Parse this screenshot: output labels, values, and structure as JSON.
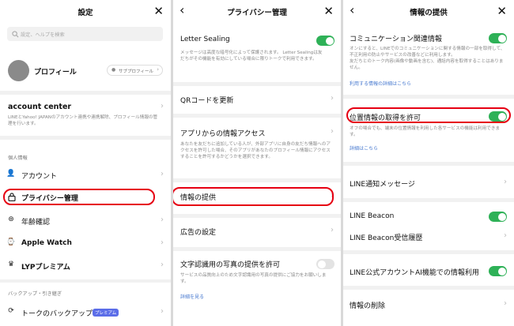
{
  "panel1": {
    "title": "設定",
    "search_placeholder": "設定、ヘルプを検索",
    "profile_label": "プロフィール",
    "sub_profile_button": "サブプロフィール",
    "account_center_title": "account center",
    "account_center_desc": "LINEとYahoo! JAPANのアカウント連携や連携解除、プロフィール情報の管理を行います。",
    "section_personal": "個人情報",
    "items": [
      "アカウント",
      "プライバシー管理",
      "年齢確認",
      "Apple Watch",
      "LYPプレミアム"
    ],
    "section_backup": "バックアップ・引き継ぎ",
    "backup_label": "トークのバックアップ",
    "premium_badge": "プレミアム"
  },
  "panel2": {
    "title": "プライバシー管理",
    "letter_sealing_title": "Letter Sealing",
    "letter_sealing_desc": "メッセージは高度な暗号化によって保護されます。 Letter Sealingは友だちがその機能を有効にしている場合に限りトークで利用できます。",
    "qr_label": "QRコードを更新",
    "app_access_title": "アプリからの情報アクセス",
    "app_access_desc": "あなたを友だちに追加している人が、外部アプリに自身の友だち情報へのアクセスを許可した場合、そのアプリがあなたのプロフィール情報にアクセスすることを許可するかどうかを選択できます。",
    "provide_info_label": "情報の提供",
    "ad_settings_label": "広告の設定",
    "photo_title": "文字認識用の写真の提供を許可",
    "photo_desc": "サービスの品質向上のため文字認識用の写真の提供にご協力をお願いします。",
    "details_link": "詳細を見る"
  },
  "panel3": {
    "title": "情報の提供",
    "comm_title": "コミュニケーション関連情報",
    "comm_desc": "オンにすると、LINEでのコミュニケーションに関する情報の一部を取得して、不正利用の防止やサービスの改善などに利用します。\n友だちとのトーク内容(画像や動画を含む)、通話内容を取得することはありません。",
    "comm_link": "利用する情報の詳細はこちら",
    "location_title": "位置情報の取得を許可",
    "location_desc": "オフの場合でも、端末の位置情報を利用した各サービスの機能は利用できます。",
    "details_link": "詳細はこちら",
    "line_notify": "LINE通知メッセージ",
    "line_beacon": "LINE Beacon",
    "beacon_history": "LINE Beacon受信履歴",
    "official_ai": "LINE公式アカウントAI機能での情報利用",
    "delete_info": "情報の削除"
  },
  "colors": {
    "accent_green": "#2eb157",
    "highlight_red": "#e60012",
    "link_blue": "#4a7bd0"
  }
}
